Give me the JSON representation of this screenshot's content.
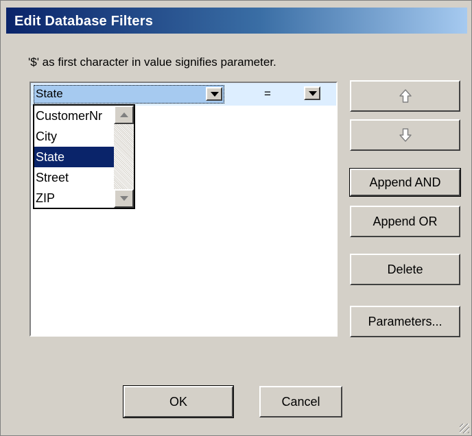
{
  "dialog": {
    "title": "Edit Database Filters",
    "hint": "'$' as first character in value signifies parameter."
  },
  "filter_row": {
    "field_value": "State",
    "operator_value": "="
  },
  "field_dropdown": {
    "items": [
      "CustomerNr",
      "City",
      "State",
      "Street",
      "ZIP"
    ],
    "selected": "State"
  },
  "buttons": {
    "move_up_icon": "up-arrow",
    "move_down_icon": "down-arrow",
    "append_and": "Append AND",
    "append_or": "Append OR",
    "delete": "Delete",
    "parameters": "Parameters...",
    "ok": "OK",
    "cancel": "Cancel"
  },
  "colors": {
    "titlebar_start": "#0a246a",
    "titlebar_end": "#a6caf0",
    "selection": "#0a246a",
    "row_highlight": "#ddeeff",
    "face": "#d4d0c8"
  }
}
